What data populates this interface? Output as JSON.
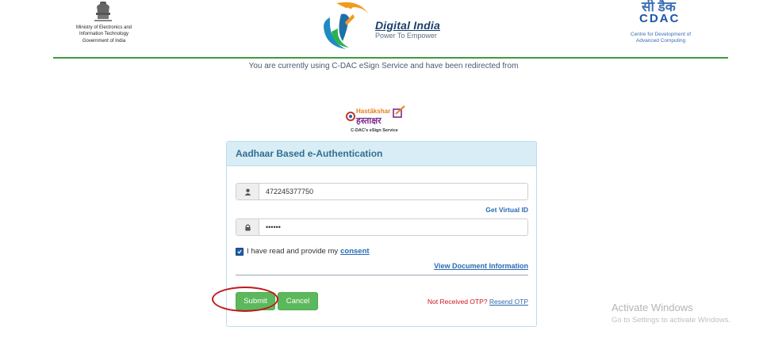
{
  "header": {
    "meity_lines": [
      "Ministry of Electronics and",
      "Information Technology"
    ],
    "meity_gov": "Government of India",
    "digital_india_title": "Digital India",
    "digital_india_tagline": "Power To Empower",
    "cdac_hindi": "सी डैक",
    "cdac_name": "CDAC",
    "cdac_full": [
      "Centre for Development of",
      "Advanced Computing"
    ],
    "redirect_message": "You are currently using C-DAC eSign Service and have been redirected from"
  },
  "hastakshar": {
    "latin": "Hastākshar",
    "hindi": "हस्ताक्षर",
    "caption": "C-DAC's eSign Service"
  },
  "panel": {
    "title": "Aadhaar Based e-Authentication",
    "aadhaar_value": "472245377750",
    "otp_value": "••••••",
    "get_virtual_id": "Get Virtual ID",
    "consent_text": "I have read and provide my",
    "consent_link": "consent",
    "view_document": "View Document Information",
    "submit_label": "Submit",
    "cancel_label": "Cancel",
    "otp_question": "Not Received OTP?",
    "resend_otp": "Resend OTP"
  },
  "watermark": {
    "title": "Activate Windows",
    "subtitle": "Go to Settings to activate Windows."
  },
  "colors": {
    "panel_header": "#d9edf7",
    "panel_title": "#31708f",
    "button_green": "#5cb85c",
    "header_line": "#3f9a3f",
    "link_blue": "#2a6ab3",
    "otp_red": "#d0141c",
    "annotation_ring": "#c0191c"
  },
  "icons": {
    "emblem": "national-emblem-icon",
    "user": "user-icon",
    "lock": "lock-icon",
    "check": "checkmark-icon"
  }
}
